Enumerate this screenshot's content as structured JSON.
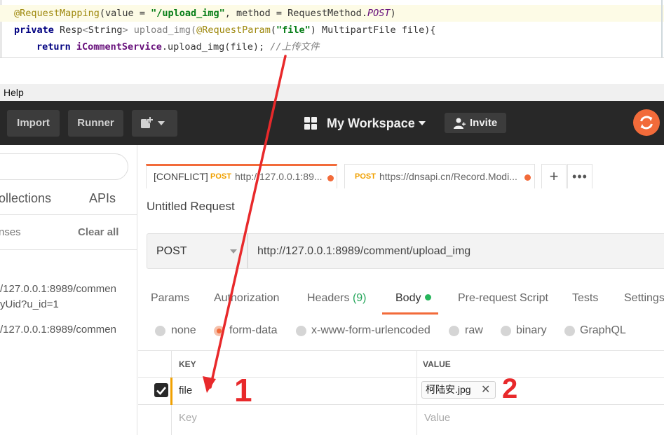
{
  "code": {
    "line1": {
      "annotation": "@RequestMapping",
      "open": "(value = ",
      "path": "\"/upload_img\"",
      "mid": ", method = RequestMethod.",
      "post": "POST",
      "close": ")"
    },
    "line2": {
      "kw_private": "private",
      "type": " Resp",
      "generic_open": "<",
      "generic_type": "String",
      "generic_close": ">",
      "method_name": " upload_img(",
      "param_annotation": "@RequestParam",
      "param_open": "(",
      "param_name": "\"file\"",
      "param_rest": ") MultipartFile file){"
    },
    "line3": {
      "kw_return": "return",
      "field": " iCommentService",
      "call": ".upload_img(file); ",
      "comment": "//上传文件"
    }
  },
  "menubar": {
    "help": "Help"
  },
  "header": {
    "import_label": "Import",
    "runner_label": "Runner",
    "workspace_label": "My Workspace",
    "invite_label": "Invite"
  },
  "sidebar": {
    "tab_collections": "ollections",
    "tab_apis": "APIs",
    "responses_label": "nses",
    "clear_all_label": "Clear all",
    "history": [
      {
        "line1": "/127.0.0.1:8989/commen",
        "line2": "yUid?u_id=1"
      },
      {
        "line1": "/127.0.0.1:8989/commen"
      }
    ]
  },
  "tabs": {
    "active": {
      "conflict": "[CONFLICT]",
      "method": "POST",
      "url": "http://127.0.0.1:89..."
    },
    "second": {
      "method": "POST",
      "url": "https://dnsapi.cn/Record.Modi..."
    },
    "plus": "+",
    "more": "•••"
  },
  "request": {
    "title": "Untitled Request",
    "method": "POST",
    "url": "http://127.0.0.1:8989/comment/upload_img"
  },
  "request_tabs": {
    "params": "Params",
    "authorization": "Authorization",
    "headers": "Headers",
    "headers_count": "(9)",
    "body": "Body",
    "prerequest": "Pre-request Script",
    "tests": "Tests",
    "settings": "Settings"
  },
  "body_types": {
    "none": "none",
    "form_data": "form-data",
    "urlencoded": "x-www-form-urlencoded",
    "raw": "raw",
    "binary": "binary",
    "graphql": "GraphQL",
    "selected": "form-data"
  },
  "kv_table": {
    "key_header": "KEY",
    "value_header": "VALUE",
    "rows": [
      {
        "key": "file",
        "value": "柯陆安.jpg",
        "checked": true
      }
    ],
    "key_placeholder": "Key",
    "value_placeholder": "Value"
  },
  "annotations": {
    "mark1": "1",
    "mark2": "2"
  },
  "colors": {
    "accent": "#f26b3a",
    "header_bg": "#282828",
    "method_post": "#f0a000",
    "annotation_red": "#e8292b",
    "success": "#26b55b"
  }
}
